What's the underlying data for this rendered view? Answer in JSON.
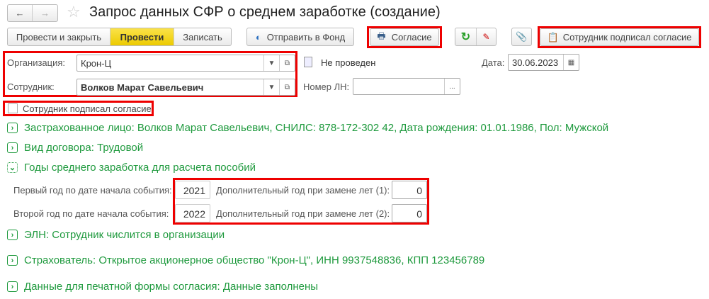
{
  "header": {
    "title": "Запрос данных СФР о среднем заработке (создание)",
    "back": "←",
    "forward": "→"
  },
  "toolbar": {
    "post_close": "Провести и закрыть",
    "post": "Провести",
    "save": "Записать",
    "send": "Отправить в Фонд",
    "consent": "Согласие",
    "signed": "Сотрудник подписал согласие"
  },
  "form": {
    "org_label": "Организация:",
    "org_value": "Крон-Ц",
    "emp_label": "Сотрудник:",
    "emp_value": "Волков Марат Савельевич",
    "status": "Не проведен",
    "date_label": "Дата:",
    "date_value": "30.06.2023",
    "ln_label": "Номер ЛН:",
    "ln_value": "",
    "ln_btn": "...",
    "checkbox_label": "Сотрудник подписал согласие"
  },
  "groups": [
    {
      "label": "Застрахованное лицо: Волков Марат Савельевич, СНИЛС: 878-172-302 42, Дата рождения: 01.01.1986, Пол: Мужской"
    },
    {
      "label": "Вид договора: Трудовой"
    },
    {
      "label": "Годы среднего заработка для расчета пособий"
    },
    {
      "label": "ЭЛН: Сотрудник числится в организации"
    },
    {
      "label": "Страхователь: Открытое акционерное общество \"Крон-Ц\", ИНН 9937548836, КПП 123456789"
    },
    {
      "label": "Данные для печатной формы согласия: Данные заполнены"
    }
  ],
  "years": {
    "first_label": "Первый год по дате начала события:",
    "first_value": "2021",
    "second_label": "Второй год по дате начала события:",
    "second_value": "2022",
    "extra1_label": "Дополнительный год при замене лет (1):",
    "extra1_value": "0",
    "extra2_label": "Дополнительный год при замене лет (2):",
    "extra2_value": "0"
  }
}
